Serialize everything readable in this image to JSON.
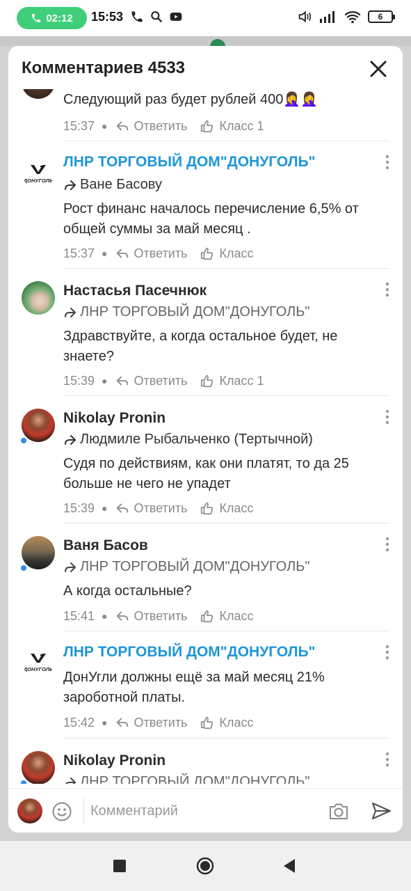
{
  "status_bar": {
    "call_timer": "02:12",
    "time": "15:53",
    "battery": "6"
  },
  "header": {
    "title": "Комментариев 4533"
  },
  "comments": [
    {
      "author": "",
      "reply_to": "",
      "text": "Следующий раз будет рублей 400🤦‍♀️🤦‍♀️",
      "time": "15:37",
      "reply_label": "Ответить",
      "like_label": "Класс 1"
    },
    {
      "author": "ЛНР ТОРГОВЫЙ ДОМ\"ДОНУГОЛЬ\"",
      "reply_to": "Ване Басову",
      "text": "Рост финанс началось перечисление 6,5% от общей суммы за май месяц .",
      "time": "15:37",
      "reply_label": "Ответить",
      "like_label": "Класс"
    },
    {
      "author": "Настасья Пасечнюк",
      "reply_to": "ЛНР ТОРГОВЫЙ ДОМ\"ДОНУГОЛЬ\"",
      "text": "Здравствуйте, а когда остальное будет, не знаете?",
      "time": "15:39",
      "reply_label": "Ответить",
      "like_label": "Класс 1"
    },
    {
      "author": "Nikolay Pronin",
      "reply_to": "Людмиле Рыбальченко (Тертычной)",
      "text": "Судя по действиям, как они платят, то да 25 больше не чего не упадет",
      "time": "15:39",
      "reply_label": "Ответить",
      "like_label": "Класс"
    },
    {
      "author": "Ваня Басов",
      "reply_to": "ЛНР ТОРГОВЫЙ ДОМ\"ДОНУГОЛЬ\"",
      "text": "А когда остальные?",
      "time": "15:41",
      "reply_label": "Ответить",
      "like_label": "Класс"
    },
    {
      "author": "ЛНР ТОРГОВЫЙ ДОМ\"ДОНУГОЛЬ\"",
      "reply_to": "",
      "text": "ДонУгли должны ещё за май месяц 21% зароботной платы.",
      "time": "15:42",
      "reply_label": "Ответить",
      "like_label": "Класс"
    },
    {
      "author": "Nikolay Pronin",
      "reply_to": "ЛНР ТОРГОВЫЙ ДОМ\"ДОНУГОЛЬ\"",
      "text": "",
      "time": "",
      "reply_label": "",
      "like_label": ""
    }
  ],
  "logo_text": "ДОНУГОЛЬ",
  "input": {
    "placeholder": "Комментарий"
  },
  "colors": {
    "accent_link": "#1e96d9",
    "call_pill": "#3fcf7a",
    "online_dot": "#2f8cf1"
  }
}
